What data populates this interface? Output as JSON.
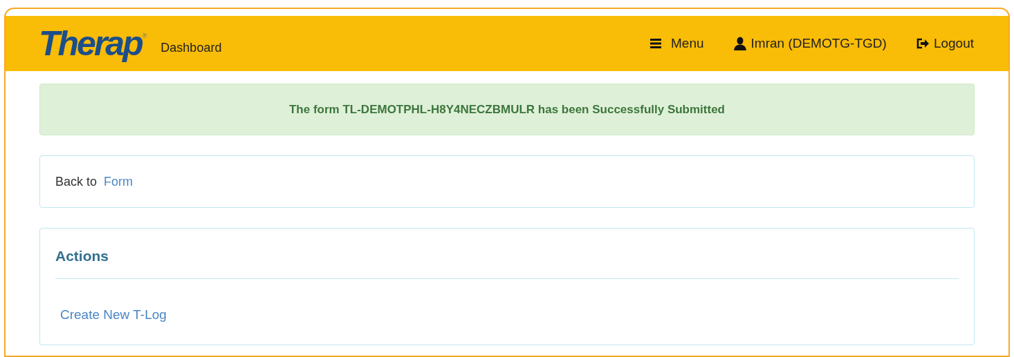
{
  "header": {
    "logo": "Therap",
    "logo_mark": "®",
    "title": "Dashboard",
    "nav": [
      {
        "kind": "menu",
        "label": "Menu"
      },
      {
        "kind": "user",
        "label": "Imran (DEMOTG-TGD)"
      },
      {
        "kind": "logout",
        "label": "Logout"
      }
    ]
  },
  "alert": {
    "message": "The form TL-DEMOTPHL-H8Y4NECZBMULR has been Successfully Submitted"
  },
  "back": {
    "label": "Back to",
    "link": "Form"
  },
  "actions": {
    "title": "Actions",
    "links": [
      "Create New T-Log"
    ]
  }
}
